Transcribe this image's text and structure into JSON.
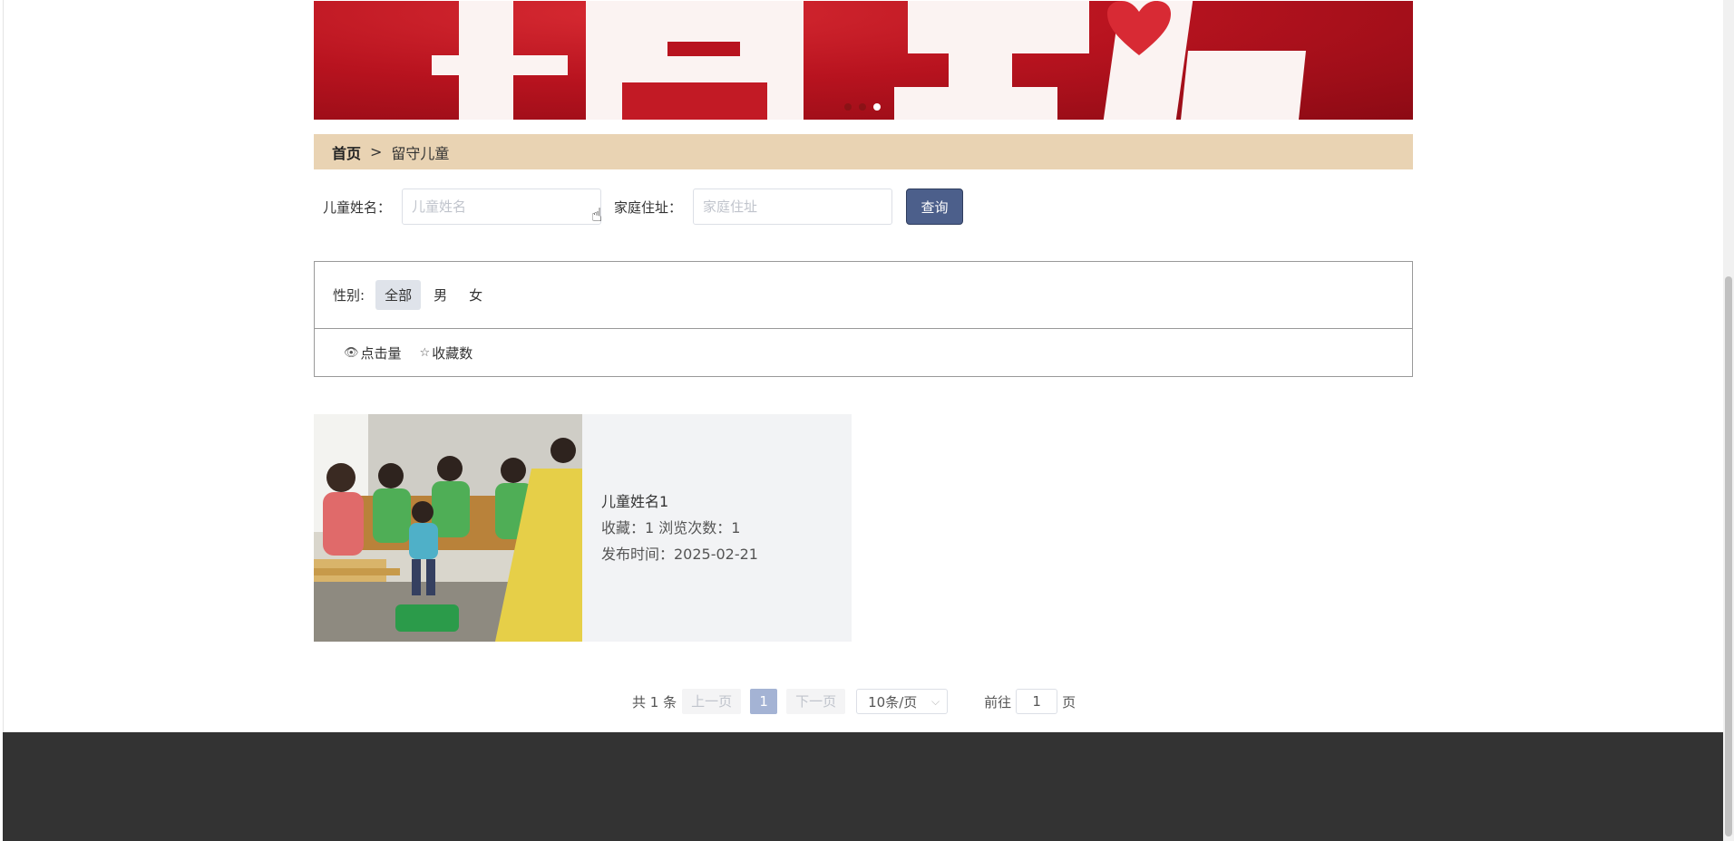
{
  "breadcrumb": {
    "home": "首页",
    "separator": ">",
    "current": "留守儿童"
  },
  "search": {
    "name_label": "儿童姓名：",
    "name_placeholder": "儿童姓名",
    "address_label": "家庭住址：",
    "address_placeholder": "家庭住址",
    "query_button": "查询"
  },
  "filter": {
    "gender_label": "性别:",
    "options": [
      "全部",
      "男",
      "女"
    ],
    "selected": "全部"
  },
  "sort": {
    "clicks": "点击量",
    "favorites": "收藏数"
  },
  "cards": [
    {
      "title": "儿童姓名1",
      "stats": "收藏：1  浏览次数：1",
      "published": "发布时间：2025-02-21"
    }
  ],
  "pagination": {
    "total": "共 1 条",
    "prev": "上一页",
    "page": "1",
    "next": "下一页",
    "page_size": "10条/页",
    "goto_label": "前往",
    "goto_value": "1",
    "goto_unit": "页"
  },
  "carousel": {
    "slides": 3,
    "active_index": 2
  },
  "colors": {
    "breadcrumb_bg": "#e9d3b3",
    "query_button": "#4c5f8b",
    "footer": "#333333",
    "banner": "#b8131f"
  }
}
